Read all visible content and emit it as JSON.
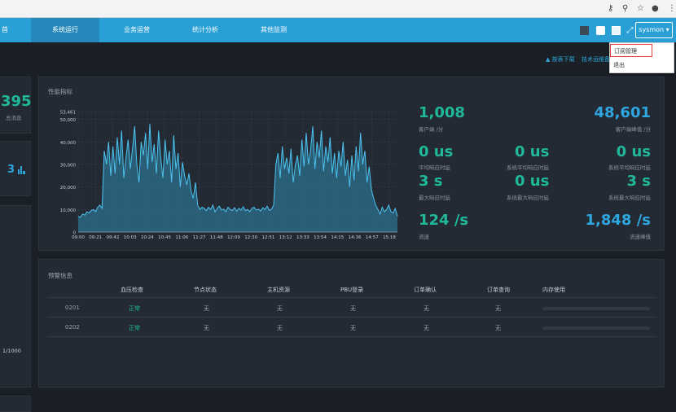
{
  "browser": {
    "icons": [
      "key-icon",
      "zoom-icon",
      "star-icon",
      "account-icon",
      "more-icon"
    ]
  },
  "nav": {
    "items": [
      {
        "label": "首"
      },
      {
        "label": "系统运行",
        "active": true
      },
      {
        "label": "业务运营"
      },
      {
        "label": "统计分析"
      },
      {
        "label": "其他监测"
      }
    ],
    "user_label": "sysmon ▾"
  },
  "dropdown": {
    "options": [
      "订阅管理",
      "退出"
    ]
  },
  "toplinks": {
    "download": "按表下载",
    "support": "技术运维备"
  },
  "left": {
    "num1": "395",
    "label1": "总消息",
    "num2": "3",
    "fraction": "1/1000"
  },
  "perf": {
    "title": "性能指标",
    "chart_data": {
      "type": "area",
      "ylim": [
        0,
        53461
      ],
      "yticks": [
        "53,461",
        "50,000",
        "40,000",
        "30,000",
        "20,000",
        "10,000",
        "0"
      ],
      "yticks_values": [
        53461,
        50000,
        40000,
        30000,
        20000,
        10000,
        0
      ],
      "xticks": [
        "09:00",
        "09:21",
        "09:42",
        "10:03",
        "10:24",
        "10:45",
        "11:06",
        "11:27",
        "11:48",
        "12:09",
        "12:30",
        "12:51",
        "13:12",
        "13:33",
        "13:54",
        "14:15",
        "14:36",
        "14:57",
        "15:18"
      ],
      "x_hint": "series sampled uniformly from 09:00 to 15:30",
      "values": [
        7000,
        6500,
        8000,
        7500,
        9000,
        8500,
        9500,
        10000,
        9000,
        11000,
        12000,
        10500,
        36000,
        30000,
        40000,
        25000,
        38000,
        26000,
        42000,
        30000,
        45000,
        24000,
        33000,
        41000,
        28000,
        37000,
        47000,
        30000,
        22000,
        40000,
        34000,
        44000,
        28000,
        48000,
        31000,
        39000,
        26000,
        45000,
        33000,
        24000,
        41000,
        30000,
        36000,
        22000,
        43000,
        28000,
        35000,
        20000,
        31000,
        25000,
        21000,
        26000,
        18000,
        15000,
        22000,
        12000,
        10000,
        11000,
        10500,
        9500,
        11000,
        10000,
        12000,
        9000,
        10500,
        11500,
        9800,
        10200,
        9000,
        11000,
        10000,
        9500,
        10800,
        9200,
        10500,
        9800,
        11200,
        9500,
        10000,
        9000,
        10500,
        11000,
        9700,
        10200,
        9400,
        10800,
        10000,
        11500,
        9600,
        10100,
        12000,
        30000,
        35000,
        24000,
        38000,
        28000,
        33000,
        26000,
        37000,
        22000,
        30000,
        34000,
        25000,
        41000,
        29000,
        44000,
        30000,
        36000,
        47000,
        28000,
        40000,
        33000,
        45000,
        27000,
        38000,
        31000,
        42000,
        26000,
        35000,
        24000,
        36000,
        29000,
        40000,
        25000,
        32000,
        20000,
        34000,
        23000,
        38000,
        27000,
        44000,
        30000,
        36000,
        22000,
        29000,
        19000,
        15000,
        12000,
        10000,
        8000,
        11000,
        9000,
        10000,
        12000,
        9000,
        8500,
        10500,
        7000
      ]
    },
    "stats": {
      "msg_count": "1,008",
      "msg_count_label": "客户端 /分",
      "peak": "48,601",
      "peak_label": "客户端峰值 /分",
      "avg1": "0 us",
      "avg1_label": "平均响应时延",
      "avg2": "0 us",
      "avg2_label": "系统平均响应时延",
      "avg3": "0 us",
      "avg3_label": "系统平均响应时延",
      "max1": "3 s",
      "max1_label": "最大响应时延",
      "max2": "0 us",
      "max2_label": "系统最大响应时延",
      "max3": "3 s",
      "max3_label": "系统最大响应时延",
      "rate": "124 /s",
      "rate_label": "流速",
      "rate_peak": "1,848 /s",
      "rate_peak_label": "流速峰值"
    }
  },
  "alert": {
    "title": "预警信息",
    "headers": [
      "血压检查",
      "节点状态",
      "主机资源",
      "PBU登录",
      "订单确认",
      "订单查询",
      "内存使用"
    ],
    "rows": [
      {
        "id": "0201",
        "cells": [
          "正常",
          "无",
          "无",
          "无",
          "无",
          "无"
        ],
        "mem": 0.0
      },
      {
        "id": "0202",
        "cells": [
          "正常",
          "无",
          "无",
          "无",
          "无",
          "无"
        ],
        "mem": 0.0
      }
    ]
  }
}
